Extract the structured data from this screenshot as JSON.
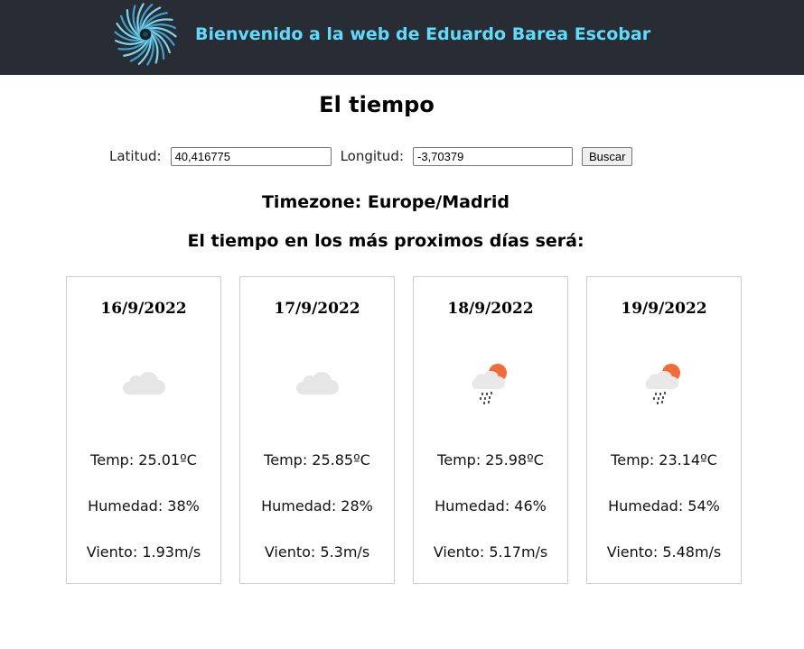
{
  "header": {
    "title": "Bienvenido a la web de Eduardo Barea Escobar",
    "logo_icon": "spiral-logo-icon",
    "background": "#282c34",
    "title_color": "#61dafb"
  },
  "main": {
    "title": "El tiempo",
    "form": {
      "latitude_label": "Latitud:",
      "latitude_value": "40,416775",
      "longitude_label": "Longitud:",
      "longitude_value": "-3,70379",
      "search_label": "Buscar"
    },
    "timezone": "Timezone: Europe/Madrid",
    "forecast_heading": "El tiempo en los más proximos días será:",
    "days": [
      {
        "date": "16/9/2022",
        "icon": "cloud-icon",
        "temp": "Temp: 25.01ºC",
        "humidity": "Humedad: 38%",
        "wind": "Viento: 1.93m/s"
      },
      {
        "date": "17/9/2022",
        "icon": "cloud-icon",
        "temp": "Temp: 25.85ºC",
        "humidity": "Humedad: 28%",
        "wind": "Viento: 5.3m/s"
      },
      {
        "date": "18/9/2022",
        "icon": "sun-cloud-rain-icon",
        "temp": "Temp: 25.98ºC",
        "humidity": "Humedad: 46%",
        "wind": "Viento: 5.17m/s"
      },
      {
        "date": "19/9/2022",
        "icon": "sun-cloud-rain-icon",
        "temp": "Temp: 23.14ºC",
        "humidity": "Humedad: 54%",
        "wind": "Viento: 5.48m/s"
      }
    ]
  }
}
